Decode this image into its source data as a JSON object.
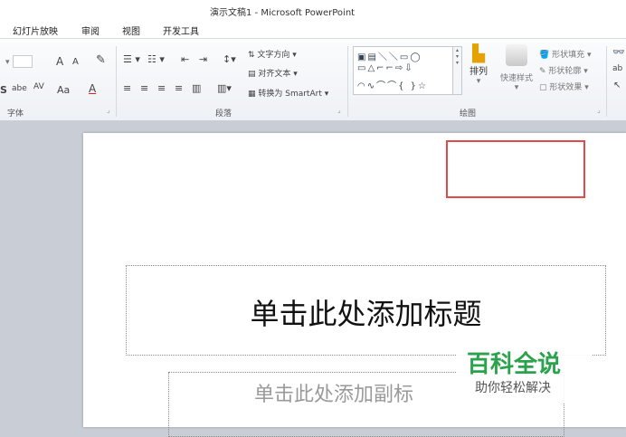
{
  "window": {
    "title": "演示文稿1 - Microsoft PowerPoint"
  },
  "tabs": [
    "幻灯片放映",
    "审阅",
    "视图",
    "开发工具"
  ],
  "ribbon": {
    "font_group": {
      "label": "字体",
      "grow_font": "A",
      "shrink_font": "A",
      "strike": "abe",
      "char_spacing": "AV",
      "change_case": "Aa",
      "font_color": "A",
      "shadow": "S"
    },
    "paragraph_group": {
      "label": "段落",
      "text_direction": "文字方向",
      "align_text": "对齐文本",
      "convert_smartart": "转换为 SmartArt"
    },
    "drawing_group": {
      "label": "绘图",
      "arrange": "排列",
      "quick_styles": "快速样式",
      "shape_fill": "形状填充",
      "shape_outline": "形状轮廓",
      "shape_effects": "形状效果"
    }
  },
  "slide": {
    "title_placeholder": "单击此处添加标题",
    "subtitle_placeholder": "单击此处添加副标"
  },
  "watermark": {
    "line1": "百科全说",
    "line2": "助你轻松解决"
  },
  "colors": {
    "highlight_box": "#e34b4b",
    "watermark": "#2ba24c"
  }
}
